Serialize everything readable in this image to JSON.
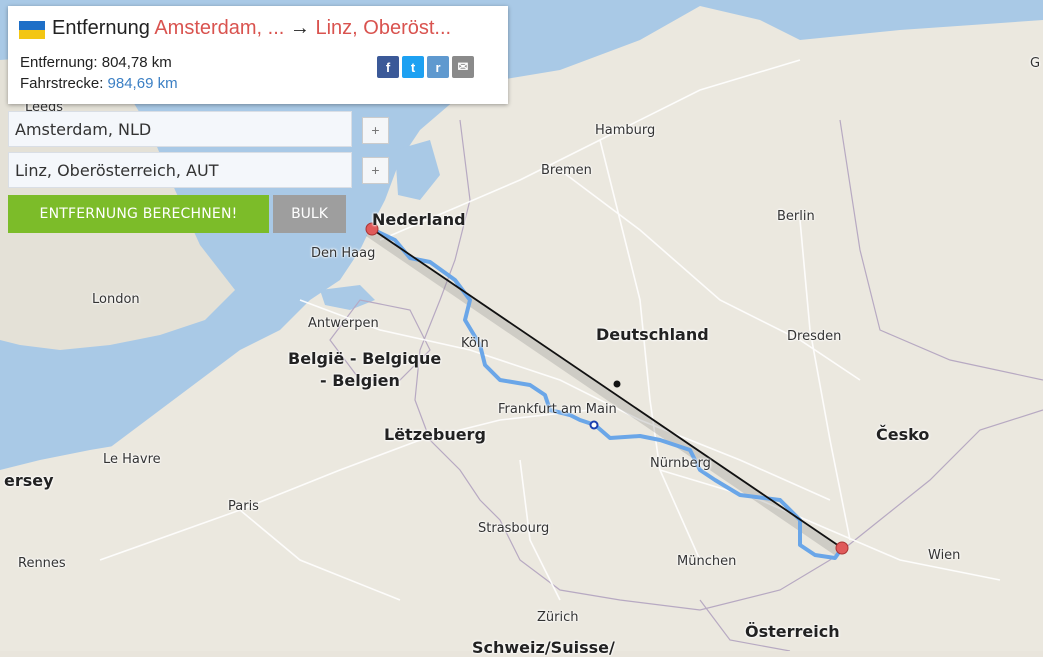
{
  "header": {
    "title_prefix": "Entfernung",
    "origin_short": "Amsterdam, ...",
    "arrow": "→",
    "destination_short": "Linz, Oberöst...",
    "distance_label": "Entfernung:",
    "distance_value": "804,78 km",
    "route_label": "Fahrstrecke:",
    "route_value": "984,69 km"
  },
  "share_icons": [
    {
      "name": "facebook-icon",
      "glyph": "f",
      "color": "#3b5998"
    },
    {
      "name": "twitter-icon",
      "glyph": "t",
      "color": "#1da1f2"
    },
    {
      "name": "reddit-icon",
      "glyph": "r",
      "color": "#5f99cf"
    },
    {
      "name": "email-icon",
      "glyph": "✉",
      "color": "#8a8a8a"
    }
  ],
  "form": {
    "origin_value": "Amsterdam, NLD",
    "destination_value": "Linz, Oberösterreich, AUT",
    "add_label": "+",
    "calculate_button": "ENTFERNUNG BERECHNEN!",
    "bulk_button": "BULK"
  },
  "map": {
    "cities": {
      "hamburg": "Hamburg",
      "bremen": "Bremen",
      "berlin": "Berlin",
      "den_haag": "Den Haag",
      "london": "London",
      "antwerpen": "Antwerpen",
      "koln": "Köln",
      "dresden": "Dresden",
      "frankfurt": "Frankfurt am Main",
      "le_havre": "Le Havre",
      "nurnberg": "Nürnberg",
      "paris": "Paris",
      "strasbourg": "Strasbourg",
      "munchen": "München",
      "wien": "Wien",
      "rennes": "Rennes",
      "zurich": "Zürich",
      "leeds": "Leeds"
    },
    "countries": {
      "nederland": "Nederland",
      "belgie_line1": "België - Belgique",
      "belgie_line2": "- Belgien",
      "deutschland": "Deutschland",
      "letzebuerg": "Lëtzebuerg",
      "cesko": "Česko",
      "osterreich": "Österreich",
      "jersey": "ersey",
      "schweiz": "Schweiz/Suisse/",
      "edge_g": "G"
    },
    "colors": {
      "water": "#a8c8e8",
      "land": "#ebe8df",
      "route": "#6aa6e8",
      "straight_line": "#111111",
      "marker": "#e05a5a"
    }
  }
}
